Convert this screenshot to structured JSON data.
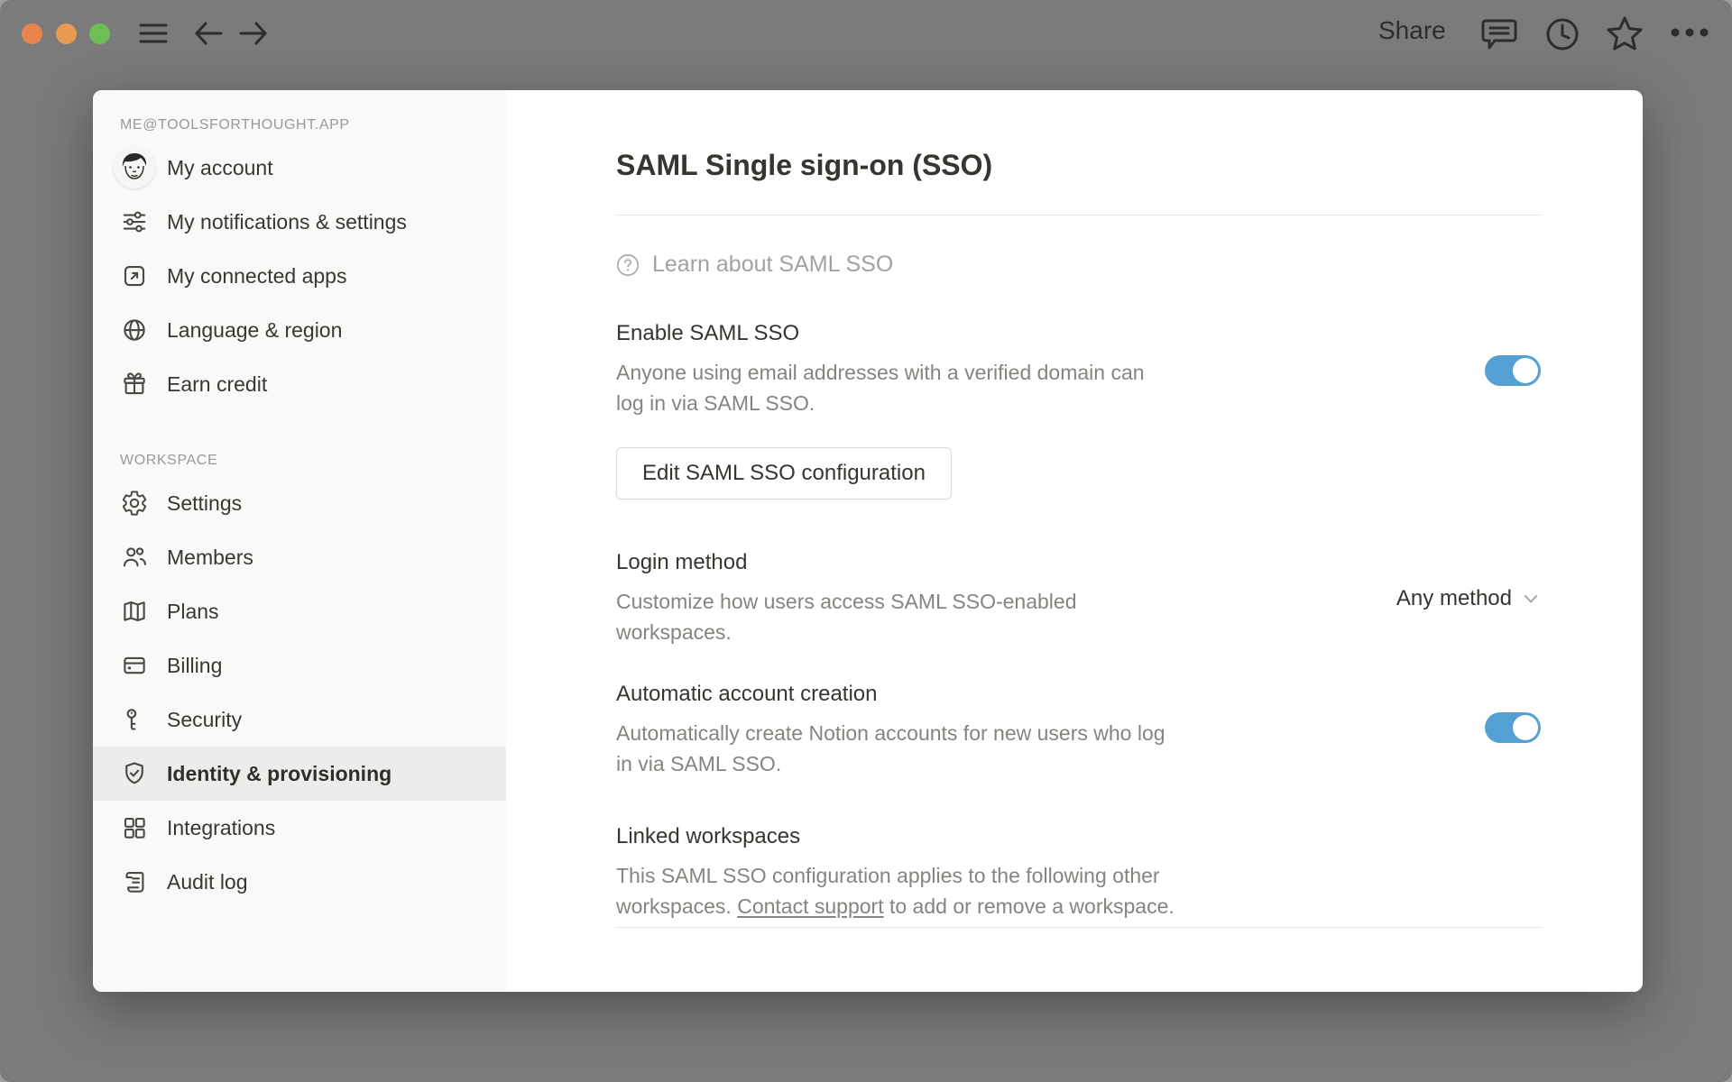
{
  "window": {
    "toolbar": {
      "share_label": "Share",
      "icons": [
        "traffic-lights",
        "hamburger-icon",
        "back-arrow-icon",
        "forward-arrow-icon",
        "comment-icon",
        "history-clock-icon",
        "star-icon",
        "ellipsis-icon"
      ]
    }
  },
  "sidebar": {
    "account_section_label": "ME@TOOLSFORTHOUGHT.APP",
    "account_items": [
      {
        "label": "My account",
        "icon": "avatar"
      },
      {
        "label": "My notifications & settings",
        "icon": "sliders-icon"
      },
      {
        "label": "My connected apps",
        "icon": "arrow-up-right-square-icon"
      },
      {
        "label": "Language & region",
        "icon": "globe-icon"
      },
      {
        "label": "Earn credit",
        "icon": "gift-icon"
      }
    ],
    "workspace_section_label": "WORKSPACE",
    "workspace_items": [
      {
        "label": "Settings",
        "icon": "gear-icon",
        "selected": false
      },
      {
        "label": "Members",
        "icon": "people-icon",
        "selected": false
      },
      {
        "label": "Plans",
        "icon": "map-icon",
        "selected": false
      },
      {
        "label": "Billing",
        "icon": "credit-card-icon",
        "selected": false
      },
      {
        "label": "Security",
        "icon": "key-icon",
        "selected": false
      },
      {
        "label": "Identity & provisioning",
        "icon": "shield-check-icon",
        "selected": true
      },
      {
        "label": "Integrations",
        "icon": "grid-icon",
        "selected": false
      },
      {
        "label": "Audit log",
        "icon": "scroll-icon",
        "selected": false
      }
    ]
  },
  "main": {
    "title": "SAML Single sign-on (SSO)",
    "learn_link_label": "Learn about SAML SSO",
    "enable": {
      "heading": "Enable SAML SSO",
      "description": "Anyone using email addresses with a verified domain can log in via SAML SSO.",
      "enabled": true
    },
    "edit_button_label": "Edit SAML SSO configuration",
    "login_method": {
      "heading": "Login method",
      "description": "Customize how users access SAML SSO-enabled workspaces.",
      "selected_value": "Any method"
    },
    "auto_account": {
      "heading": "Automatic account creation",
      "description": "Automatically create Notion accounts for new users who log in via SAML SSO.",
      "enabled": true
    },
    "linked_workspaces": {
      "heading": "Linked workspaces",
      "description_before_link": "This SAML SSO configuration applies to the following other workspaces. ",
      "link_label": "Contact support",
      "description_after_link": " to add or remove a workspace."
    }
  },
  "colors": {
    "toggle_on": "#54a0d5",
    "modal_background": "#ffffff",
    "sidebar_background": "#f9f9f8",
    "selected_item_background": "#ececea",
    "overlay_background": "#7b7b7b",
    "traffic_red": "#e8854e",
    "traffic_yellow": "#e79a50",
    "traffic_green": "#6fbe55"
  }
}
